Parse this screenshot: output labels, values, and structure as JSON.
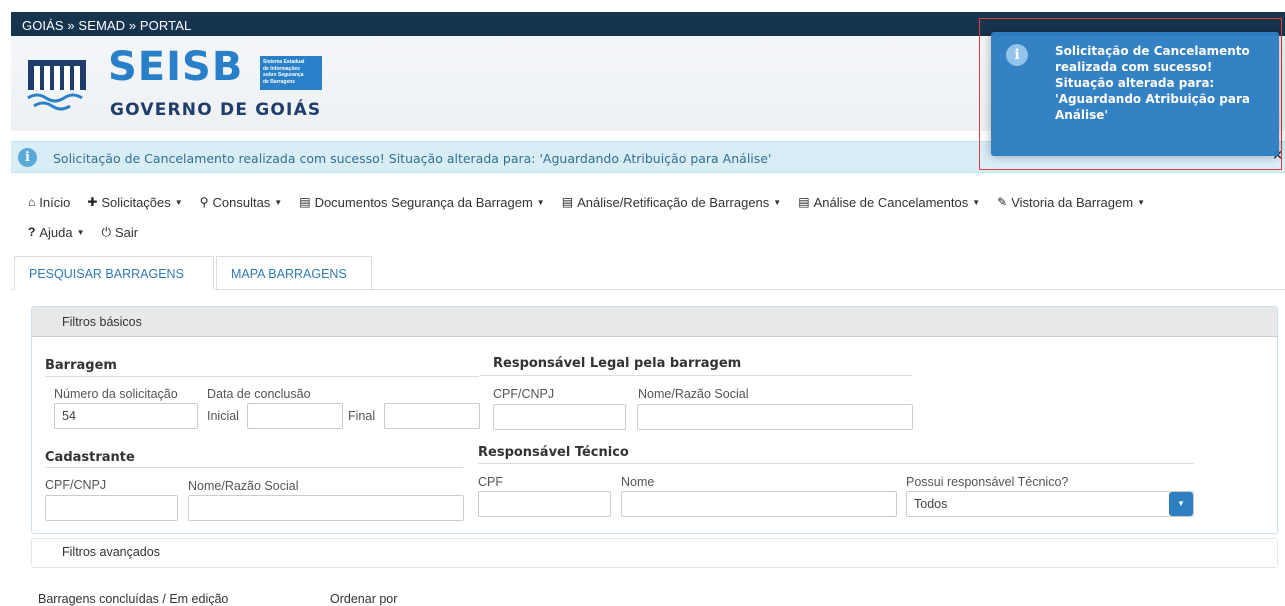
{
  "breadcrumb": "GOIÁS » SEMAD » PORTAL",
  "logo": {
    "name": "SEISB",
    "subtitle_lines": [
      "Sistema Estadual",
      "de Informações",
      "sobre Segurança",
      "de Barragens"
    ],
    "government": "GOVERNO DE GOIÁS"
  },
  "alert": {
    "message": "Solicitação de Cancelamento realizada com sucesso! Situação alterada para: 'Aguardando Atribuição para Análise'",
    "close": "×"
  },
  "toast": {
    "message": "Solicitação de Cancelamento realizada com sucesso! Situação alterada para: 'Aguardando Atribuição para Análise'"
  },
  "nav": {
    "inicio": "Início",
    "solicitacoes": "Solicitações",
    "consultas": "Consultas",
    "documentos": "Documentos Segurança da Barragem",
    "analise_retificacao": "Análise/Retificação de Barragens",
    "analise_cancelamentos": "Análise de Cancelamentos",
    "vistoria": "Vistoria da Barragem",
    "ajuda": "Ajuda",
    "sair": "Sair"
  },
  "tabs": {
    "pesquisar": "PESQUISAR BARRAGENS",
    "mapa": "MAPA BARRAGENS"
  },
  "filters": {
    "basic_title": "Filtros básicos",
    "barragem": {
      "title": "Barragem",
      "numero_label": "Número da solicitação",
      "numero_value": "54",
      "data_label": "Data de conclusão",
      "inicial_label": "Inicial",
      "inicial_value": "",
      "final_label": "Final",
      "final_value": ""
    },
    "responsavel_legal": {
      "title": "Responsável Legal pela barragem",
      "cpf_label": "CPF/CNPJ",
      "nome_label": "Nome/Razão Social"
    },
    "cadastrante": {
      "title": "Cadastrante",
      "cpf_label": "CPF/CNPJ",
      "nome_label": "Nome/Razão Social"
    },
    "responsavel_tecnico": {
      "title": "Responsável Técnico",
      "cpf_label": "CPF",
      "nome_label": "Nome",
      "possui_label": "Possui responsável Técnico?",
      "possui_value": "Todos"
    },
    "advanced_title": "Filtros avançados"
  },
  "footer": {
    "barragens_label": "Barragens concluídas / Em edição",
    "ordenar_label": "Ordenar por"
  }
}
